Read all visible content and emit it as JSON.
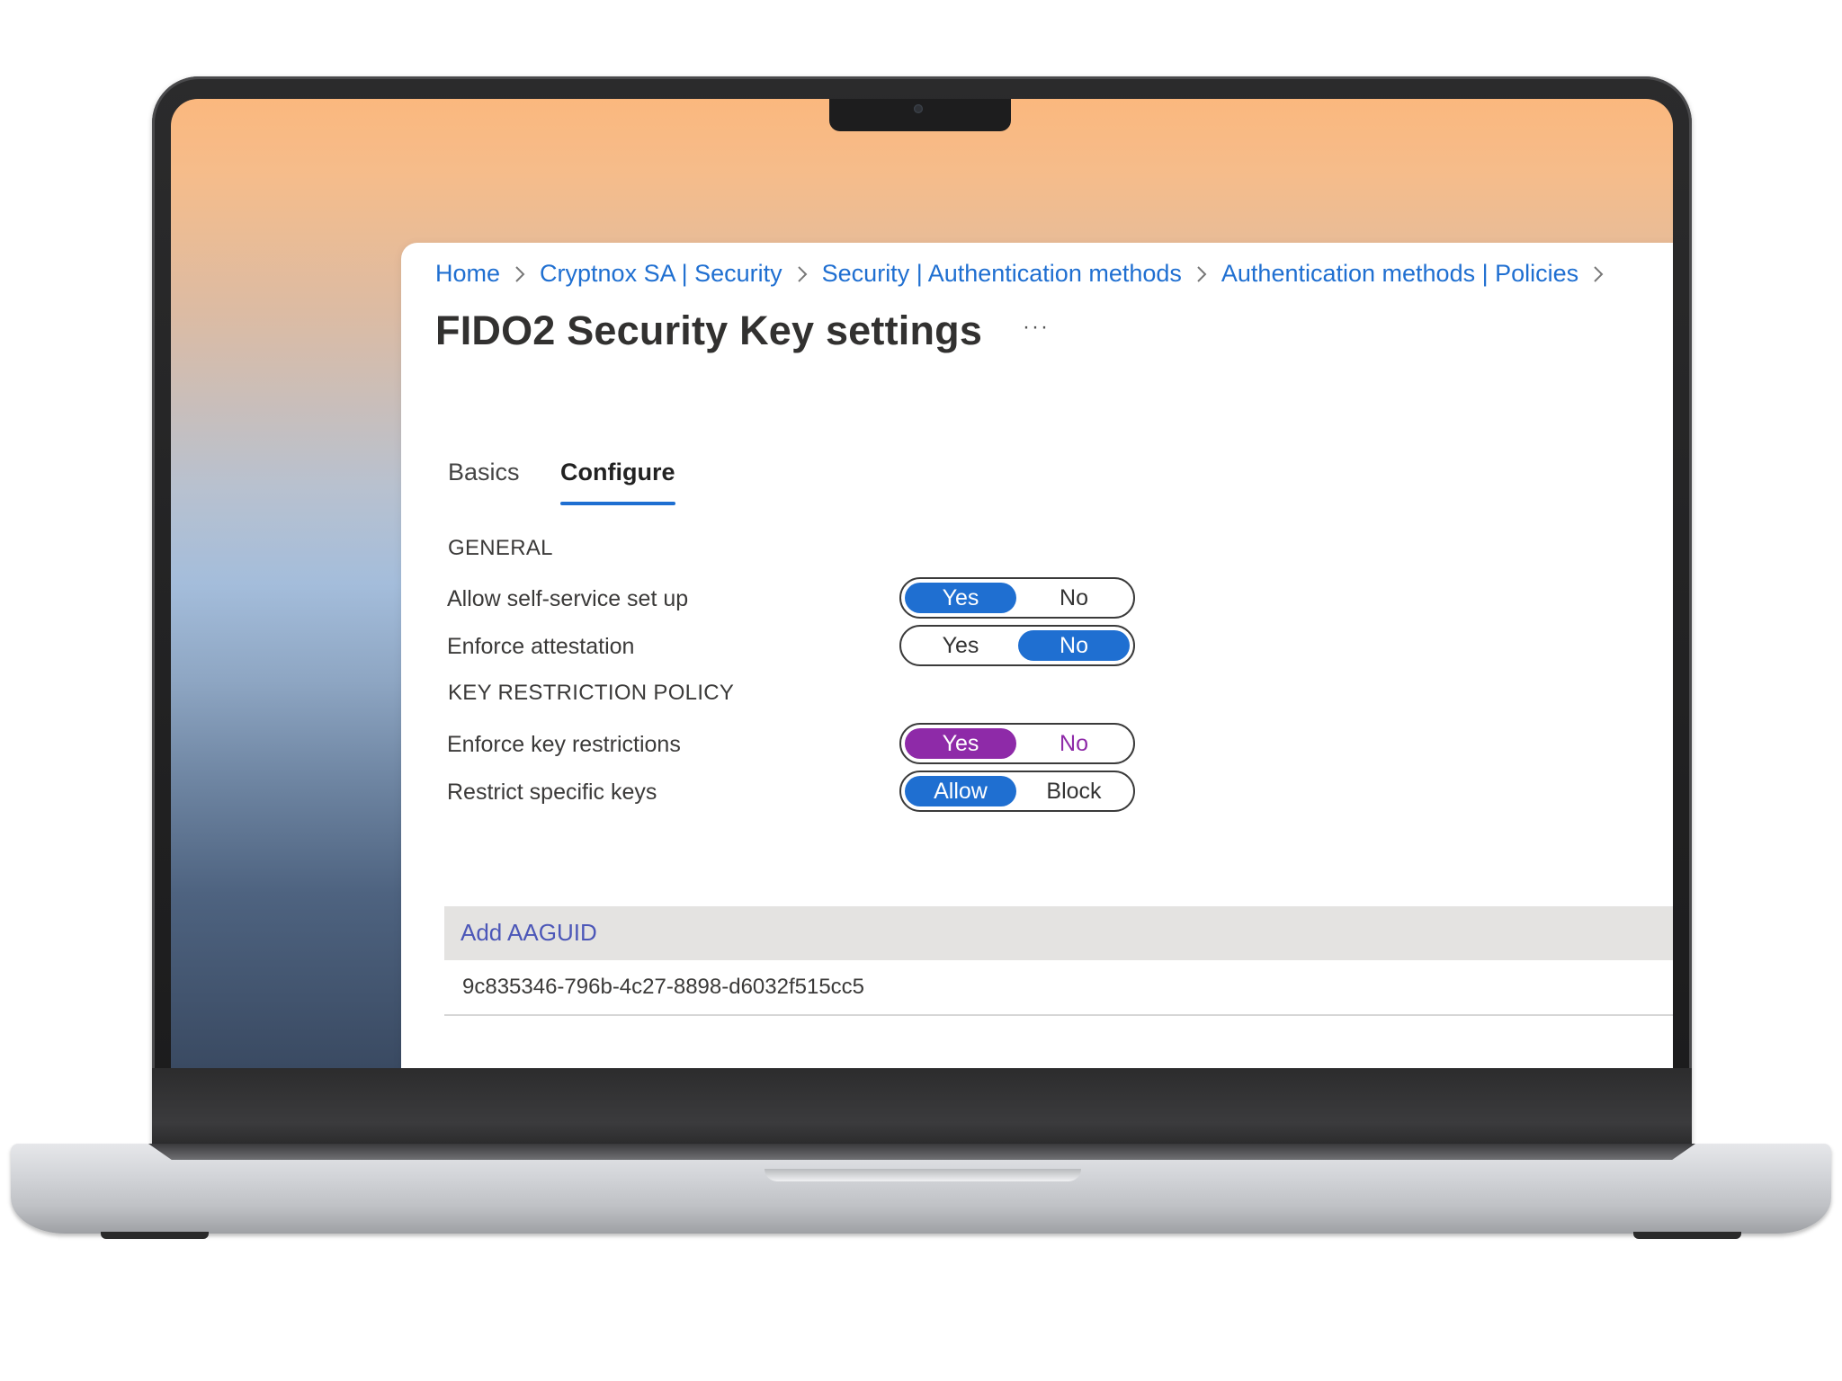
{
  "breadcrumb": [
    {
      "label": "Home"
    },
    {
      "label": "Cryptnox SA | Security"
    },
    {
      "label": "Security | Authentication methods"
    },
    {
      "label": "Authentication methods | Policies"
    }
  ],
  "page": {
    "title": "FIDO2 Security Key settings",
    "more": "···"
  },
  "tabs": [
    {
      "label": "Basics",
      "selected": false
    },
    {
      "label": "Configure",
      "selected": true
    }
  ],
  "sections": {
    "general": "GENERAL",
    "key_restriction": "KEY RESTRICTION POLICY"
  },
  "settings": [
    {
      "label": "Allow self-service set up",
      "options": [
        "Yes",
        "No"
      ],
      "selected": "Yes"
    },
    {
      "label": "Enforce attestation",
      "options": [
        "Yes",
        "No"
      ],
      "selected": "No"
    },
    {
      "label": "Enforce key restrictions",
      "options": [
        "Yes",
        "No"
      ],
      "selected": "Yes"
    },
    {
      "label": "Restrict specific keys",
      "options": [
        "Allow",
        "Block"
      ],
      "selected": "Allow"
    }
  ],
  "aaguid": {
    "add_label": "Add AAGUID",
    "items": [
      "9c835346-796b-4c27-8898-d6032f515cc5"
    ]
  },
  "colors": {
    "accent_blue": "#1f6fd1",
    "accent_purple": "#8e2aa8",
    "link": "#1f6fd1"
  }
}
